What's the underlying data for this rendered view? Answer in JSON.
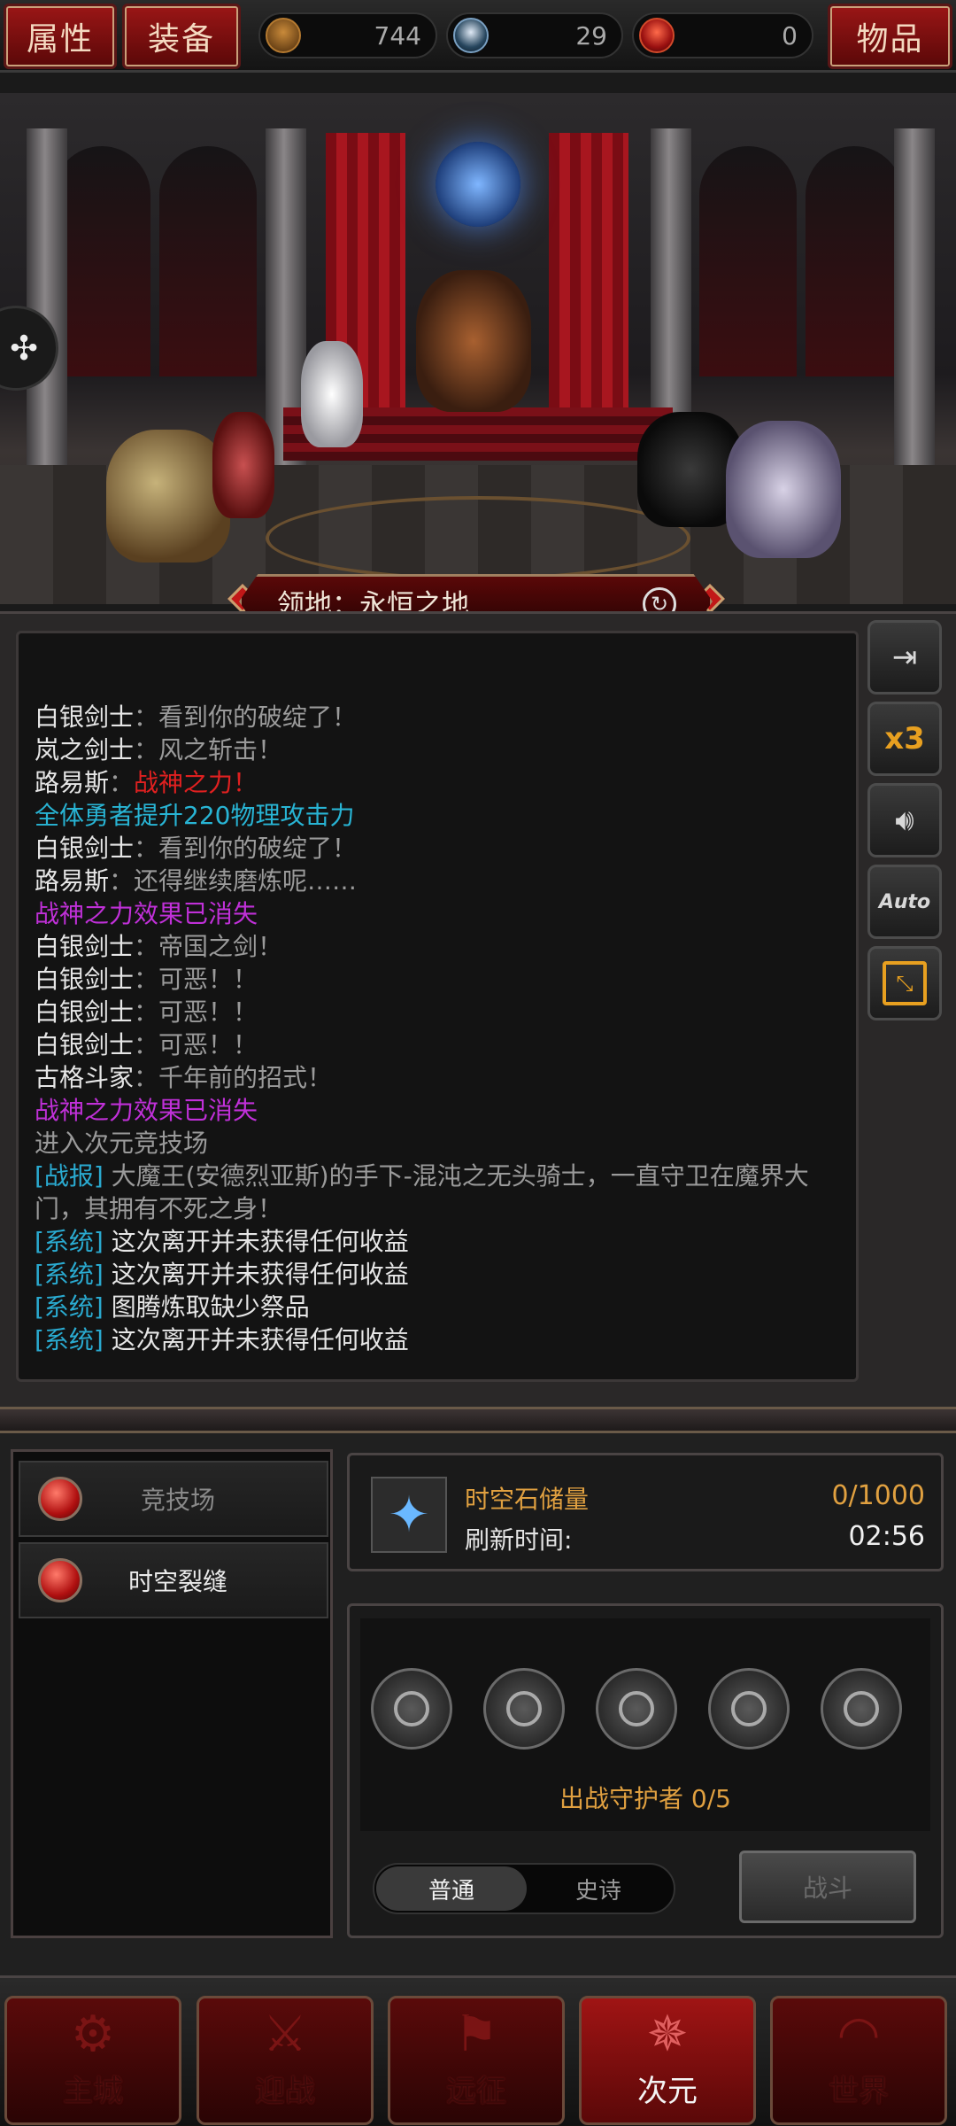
{
  "topbar": {
    "attributes_label": "属性",
    "equipment_label": "装备",
    "items_label": "物品",
    "currencies": [
      {
        "icon": "bronze-emblem-icon",
        "value": "744"
      },
      {
        "icon": "blue-crystal-icon",
        "value": "29"
      },
      {
        "icon": "red-flame-icon",
        "value": "0"
      }
    ]
  },
  "territory": {
    "label": "领地：永恒之地",
    "refresh_icon": "refresh-icon"
  },
  "log": [
    [
      {
        "t": "白银剑士",
        "c": "name"
      },
      {
        "t": "：看到你的破绽了！",
        "c": "dim"
      }
    ],
    [
      {
        "t": "岚之剑士",
        "c": "name"
      },
      {
        "t": "：风之斩击！",
        "c": "dim"
      }
    ],
    [
      {
        "t": "路易斯",
        "c": "name"
      },
      {
        "t": "：",
        "c": "dim"
      },
      {
        "t": "战神之力！",
        "c": "red"
      }
    ],
    [
      {
        "t": "全体勇者提升220物理攻击力",
        "c": "cyan"
      }
    ],
    [
      {
        "t": "白银剑士",
        "c": "name"
      },
      {
        "t": "：看到你的破绽了！",
        "c": "dim"
      }
    ],
    [
      {
        "t": "路易斯",
        "c": "name"
      },
      {
        "t": "：还得继续磨炼呢……",
        "c": "dim"
      }
    ],
    [
      {
        "t": "战神之力效果已消失",
        "c": "purple"
      }
    ],
    [
      {
        "t": "白银剑士",
        "c": "name"
      },
      {
        "t": "：帝国之剑！",
        "c": "dim"
      }
    ],
    [
      {
        "t": "白银剑士",
        "c": "name"
      },
      {
        "t": "：可恶！！",
        "c": "dim"
      }
    ],
    [
      {
        "t": "白银剑士",
        "c": "name"
      },
      {
        "t": "：可恶！！",
        "c": "dim"
      }
    ],
    [
      {
        "t": "白银剑士",
        "c": "name"
      },
      {
        "t": "：可恶！！",
        "c": "dim"
      }
    ],
    [
      {
        "t": "古格斗家",
        "c": "name"
      },
      {
        "t": "：千年前的招式！",
        "c": "dim"
      }
    ],
    [
      {
        "t": "战神之力效果已消失",
        "c": "purple"
      }
    ],
    [
      {
        "t": "进入次元竞技场",
        "c": "dim"
      }
    ],
    [
      {
        "t": "[战报]",
        "c": "tag"
      },
      {
        "t": " 大魔王(安德烈亚斯)的手下-混沌之无头骑士，一直守卫在魔界大门，其拥有不死之身！",
        "c": "dim"
      }
    ],
    [
      {
        "t": "[系统]",
        "c": "tag"
      },
      {
        "t": " 这次离开并未获得任何收益",
        "c": "name"
      }
    ],
    [
      {
        "t": "[系统]",
        "c": "tag"
      },
      {
        "t": " 这次离开并未获得任何收益",
        "c": "name"
      }
    ],
    [
      {
        "t": "[系统]",
        "c": "tag"
      },
      {
        "t": " 图腾炼取缺少祭品",
        "c": "name"
      }
    ],
    [
      {
        "t": "[系统]",
        "c": "tag"
      },
      {
        "t": " 这次离开并未获得任何收益",
        "c": "name"
      }
    ]
  ],
  "side_buttons": {
    "exit_icon": "exit-icon",
    "speed_label": "x3",
    "sound_icon": "speaker-icon",
    "auto_label": "Auto",
    "expand_icon": "collapse-icon"
  },
  "modes": [
    {
      "label": "竞技场",
      "selected": false
    },
    {
      "label": "时空裂缝",
      "selected": true
    }
  ],
  "stone": {
    "storage_label": "时空石储量",
    "storage_value": "0/1000",
    "refresh_label": "刷新时间:",
    "refresh_value": "02:56"
  },
  "guardians": {
    "count_label": "出战守护者 0/5",
    "tab_normal": "普通",
    "tab_epic": "史诗",
    "fight_label": "战斗"
  },
  "nav": [
    {
      "label": "主城",
      "icon": "castle-icon",
      "active": false
    },
    {
      "label": "迎战",
      "icon": "crossed-swords-icon",
      "active": false
    },
    {
      "label": "远征",
      "icon": "flag-icon",
      "active": false
    },
    {
      "label": "次元",
      "icon": "portal-icon",
      "active": true
    },
    {
      "label": "世界",
      "icon": "globe-icon",
      "active": false
    }
  ],
  "colors": {
    "accent_red": "#a01414",
    "gold": "#e0a040",
    "cyan": "#28b4d4",
    "purple": "#c030d8",
    "skill_red": "#e02020"
  }
}
